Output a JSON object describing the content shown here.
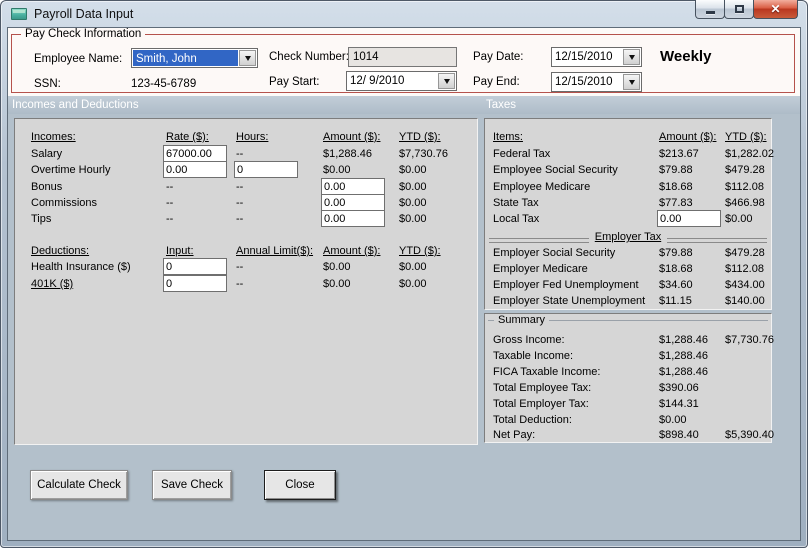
{
  "window": {
    "title": "Payroll Data Input"
  },
  "icons": {
    "close_glyph": "✕"
  },
  "colors": {
    "accent_border": "#b5524c",
    "selection_blue": "#3166c5",
    "section_bg": "#b3c0cb",
    "panel_bg": "#d6d6d6",
    "close_button_red": "#c23a22",
    "titlebar": "#c5d2df"
  },
  "paycheck": {
    "legend": "Pay Check Information",
    "employee_name": {
      "label": "Employee Name:",
      "value": "Smith, John"
    },
    "ssn": {
      "label": "SSN:",
      "value": "123-45-6789"
    },
    "check_number": {
      "label": "Check Number:",
      "value": "1014"
    },
    "pay_start": {
      "label": "Pay Start:",
      "value": "12/ 9/2010"
    },
    "pay_date": {
      "label": "Pay Date:",
      "value": "12/15/2010"
    },
    "pay_end": {
      "label": "Pay End:",
      "value": "12/15/2010"
    },
    "frequency": "Weekly"
  },
  "sections": {
    "left": "Incomes and Deductions",
    "right": "Taxes"
  },
  "incomes": {
    "headers": {
      "c1": "Incomes:",
      "c2": "Rate ($):",
      "c3": "Hours:",
      "c4": "Amount ($):",
      "c5": "YTD ($):"
    },
    "rows": [
      {
        "label": "Salary",
        "rate": "67000.00",
        "hours": "--",
        "amount": "$1,288.46",
        "ytd": "$7,730.76"
      },
      {
        "label": "Overtime Hourly",
        "rate": "0.00",
        "hours": "0",
        "amount": "$0.00",
        "ytd": "$0.00"
      },
      {
        "label": "Bonus",
        "rate": "--",
        "hours": "--",
        "amount": "0.00",
        "ytd": "$0.00"
      },
      {
        "label": "Commissions",
        "rate": "--",
        "hours": "--",
        "amount": "0.00",
        "ytd": "$0.00"
      },
      {
        "label": "Tips",
        "rate": "--",
        "hours": "--",
        "amount": "0.00",
        "ytd": "$0.00"
      }
    ]
  },
  "deductions": {
    "headers": {
      "c1": "Deductions:",
      "c2": "Input:",
      "c3": "Annual Limit($):",
      "c4": "Amount ($):",
      "c5": "YTD ($):"
    },
    "rows": [
      {
        "label": "Health Insurance ($)",
        "input": "0",
        "limit": "--",
        "amount": "$0.00",
        "ytd": "$0.00"
      },
      {
        "label": "401K ($)",
        "input": "0",
        "limit": "--",
        "amount": "$0.00",
        "ytd": "$0.00"
      }
    ]
  },
  "taxes": {
    "headers": {
      "c1": "Items:",
      "c2": "Amount ($):",
      "c3": "YTD ($):"
    },
    "employee_rows": [
      {
        "label": "Federal Tax",
        "amount": "$213.67",
        "ytd": "$1,282.02"
      },
      {
        "label": "Employee Social Security",
        "amount": "$79.88",
        "ytd": "$479.28"
      },
      {
        "label": "Employee Medicare",
        "amount": "$18.68",
        "ytd": "$112.08"
      },
      {
        "label": "State Tax",
        "amount": "$77.83",
        "ytd": "$466.98"
      },
      {
        "label": "Local Tax",
        "amount": "0.00",
        "ytd": "$0.00"
      }
    ],
    "employer_header": "Employer Tax",
    "employer_rows": [
      {
        "label": "Employer Social Security",
        "amount": "$79.88",
        "ytd": "$479.28"
      },
      {
        "label": "Employer Medicare",
        "amount": "$18.68",
        "ytd": "$112.08"
      },
      {
        "label": "Employer Fed Unemployment",
        "amount": "$34.60",
        "ytd": "$434.00"
      },
      {
        "label": "Employer State Unemployment",
        "amount": "$11.15",
        "ytd": "$140.00"
      }
    ]
  },
  "summary": {
    "legend": "Summary",
    "rows": [
      {
        "label": "Gross Income:",
        "amount": "$1,288.46",
        "ytd": "$7,730.76"
      },
      {
        "label": "Taxable Income:",
        "amount": "$1,288.46",
        "ytd": ""
      },
      {
        "label": "FICA Taxable Income:",
        "amount": "$1,288.46",
        "ytd": ""
      },
      {
        "label": "Total Employee Tax:",
        "amount": "$390.06",
        "ytd": ""
      },
      {
        "label": "Total Employer Tax:",
        "amount": "$144.31",
        "ytd": ""
      },
      {
        "label": "Total Deduction:",
        "amount": "$0.00",
        "ytd": ""
      },
      {
        "label": "Net Pay:",
        "amount": "$898.40",
        "ytd": "$5,390.40"
      }
    ]
  },
  "buttons": {
    "calculate": "Calculate Check",
    "save": "Save Check",
    "close": "Close"
  }
}
